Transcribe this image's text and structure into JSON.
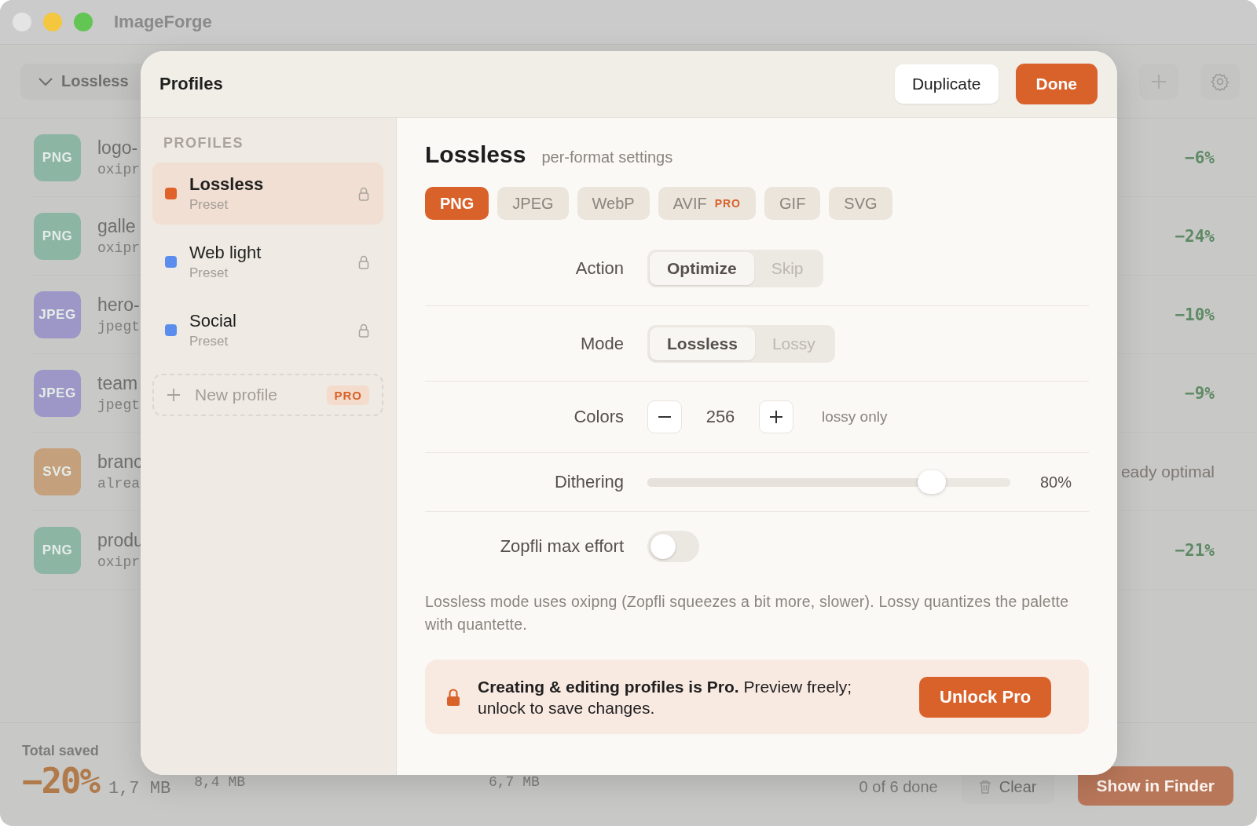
{
  "window": {
    "title": "ImageForge"
  },
  "toolbar": {
    "profile_dropdown": "Lossless"
  },
  "files": [
    {
      "badge": "PNG",
      "color": "#8cb5a3",
      "name": "logo-",
      "tool": "oxipr",
      "result": "−6%",
      "kind": "saving"
    },
    {
      "badge": "PNG",
      "color": "#8cb5a3",
      "name": "galle",
      "tool": "oxipr",
      "result": "−24%",
      "kind": "saving"
    },
    {
      "badge": "JPEG",
      "color": "#9c97c6",
      "name": "hero-",
      "tool": "jpegt",
      "result": "−10%",
      "kind": "saving"
    },
    {
      "badge": "JPEG",
      "color": "#9c97c6",
      "name": "team",
      "tool": "jpegt",
      "result": "−9%",
      "kind": "saving"
    },
    {
      "badge": "SVG",
      "color": "#c4a07c",
      "name": "branc",
      "tool": "alrea",
      "result": "eady optimal",
      "kind": "note"
    },
    {
      "badge": "PNG",
      "color": "#8cb5a3",
      "name": "produ",
      "tool": "oxipr",
      "result": "−21%",
      "kind": "saving"
    }
  ],
  "footer": {
    "label": "Total saved",
    "percent": "−20%",
    "saved": "1,7 MB",
    "original": "8,4 MB",
    "optimized": "6,7 MB",
    "status": "0 of 6 done",
    "clear": "Clear",
    "finder": "Show in Finder"
  },
  "modal": {
    "title": "Profiles",
    "duplicate": "Duplicate",
    "done": "Done",
    "sidebar_heading": "PROFILES",
    "profiles": [
      {
        "name": "Lossless",
        "subtitle": "Preset",
        "color": "#e0622a",
        "selected": true,
        "locked": true
      },
      {
        "name": "Web light",
        "subtitle": "Preset",
        "color": "#5b8def",
        "selected": false,
        "locked": true
      },
      {
        "name": "Social",
        "subtitle": "Preset",
        "color": "#5b8def",
        "selected": false,
        "locked": true
      }
    ],
    "new_profile": {
      "label": "New profile",
      "badge": "PRO"
    },
    "editor": {
      "title": "Lossless",
      "subtitle": "per-format settings",
      "formats": [
        {
          "label": "PNG",
          "selected": true
        },
        {
          "label": "JPEG",
          "selected": false
        },
        {
          "label": "WebP",
          "selected": false
        },
        {
          "label": "AVIF",
          "selected": false,
          "pro": "PRO"
        },
        {
          "label": "GIF",
          "selected": false
        },
        {
          "label": "SVG",
          "selected": false
        }
      ],
      "settings": [
        {
          "kind": "segmented",
          "label": "Action",
          "options": [
            {
              "label": "Optimize",
              "selected": true
            },
            {
              "label": "Skip",
              "selected": false
            }
          ]
        },
        {
          "kind": "segmented",
          "label": "Mode",
          "options": [
            {
              "label": "Lossless",
              "selected": true
            },
            {
              "label": "Lossy",
              "selected": false
            }
          ]
        },
        {
          "kind": "stepper",
          "label": "Colors",
          "value": "256",
          "note": "lossy only"
        },
        {
          "kind": "slider",
          "label": "Dithering",
          "level": 0.8,
          "reading": "80%"
        },
        {
          "kind": "toggle",
          "label": "Zopfli max effort",
          "on": false
        }
      ],
      "description": "Lossless mode uses oxipng (Zopfli squeezes a bit more, slower). Lossy quantizes the palette with quantette.",
      "banner": {
        "text": "**Creating & editing profiles is Pro.**  Preview freely; unlock to save changes.",
        "button": "Unlock Pro"
      }
    }
  }
}
